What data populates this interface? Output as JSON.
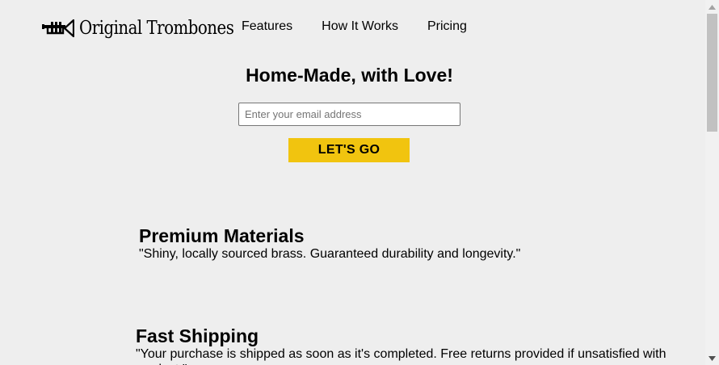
{
  "header": {
    "logo_icon": "trumpet-icon",
    "brand": "Original Trombones",
    "nav": [
      {
        "label": "Features"
      },
      {
        "label": "How It Works"
      },
      {
        "label": "Pricing"
      }
    ]
  },
  "hero": {
    "title": "Home-Made, with Love!",
    "email_placeholder": "Enter your email address",
    "email_value": "",
    "button_label": "LET'S GO",
    "button_color": "#f1c40f"
  },
  "features": [
    {
      "title": "Premium Materials",
      "text": "\"Shiny, locally sourced brass. Guaranteed durability and longevity.\""
    },
    {
      "title": "Fast Shipping",
      "text": "\"Your purchase is shipped as soon as it's completed. Free returns provided if unsatisfied with product.\""
    }
  ],
  "colors": {
    "background": "#eeeeee",
    "accent": "#f1c40f"
  },
  "scrollbar": {
    "up_icon": "arrow-up-icon",
    "down_icon": "arrow-down-icon"
  }
}
